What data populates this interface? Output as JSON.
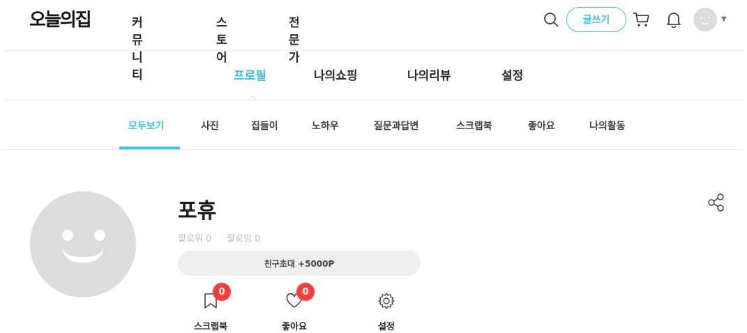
{
  "header": {
    "logo": "오늘의집",
    "nav": [
      "커뮤니티",
      "스토어",
      "전문가"
    ],
    "write_label": "글쓰기",
    "icons": [
      "search-icon",
      "cart-icon",
      "bell-icon"
    ]
  },
  "sub_nav": {
    "tabs": [
      "프로필",
      "나의쇼핑",
      "나의리뷰",
      "설정"
    ],
    "active_index": 0
  },
  "categories": {
    "items": [
      "모두보기",
      "사진",
      "집들이",
      "노하우",
      "질문과답변",
      "스크랩북",
      "좋아요",
      "나의활동"
    ],
    "active_index": 0
  },
  "profile": {
    "name": "포휴",
    "follower": "팔로워 0",
    "following": "팔로잉 0",
    "invite_label": "친구초대 +5000P",
    "stats": [
      {
        "label": "스크랩북",
        "badge": "0",
        "icon": "bookmark-icon"
      },
      {
        "label": "좋아요",
        "badge": "0",
        "icon": "heart-icon"
      },
      {
        "label": "설정",
        "icon": "gear-icon"
      }
    ]
  },
  "colors": {
    "accent": "#35c5f0",
    "badge": "#ff3b3b",
    "avatar": "#dcdcdc"
  }
}
